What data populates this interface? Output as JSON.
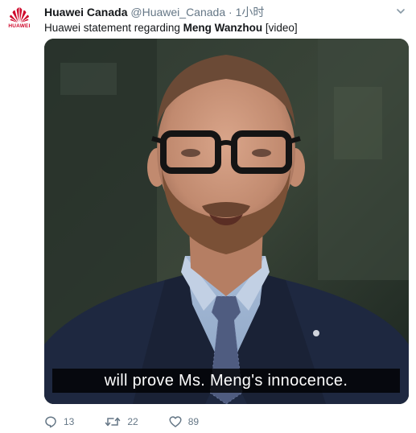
{
  "tweet": {
    "author_name": "Huawei Canada",
    "author_handle": "@Huawei_Canada",
    "separator": "·",
    "time": "1小时",
    "text_before": "Huawei statement regarding ",
    "text_bold": "Meng Wanzhou",
    "text_after": " [video]",
    "avatar": {
      "brand_text": "HUAWEI",
      "logo_icon": "huawei-logo-icon",
      "brand_color": "#cf0a2c"
    }
  },
  "media": {
    "subtitle": "will prove Ms. Meng's innocence."
  },
  "actions": {
    "reply_count": "13",
    "retweet_count": "22",
    "like_count": "89",
    "reply_icon": "reply-icon",
    "retweet_icon": "retweet-icon",
    "like_icon": "heart-icon"
  },
  "colors": {
    "text_primary": "#14171a",
    "text_secondary": "#657786"
  }
}
